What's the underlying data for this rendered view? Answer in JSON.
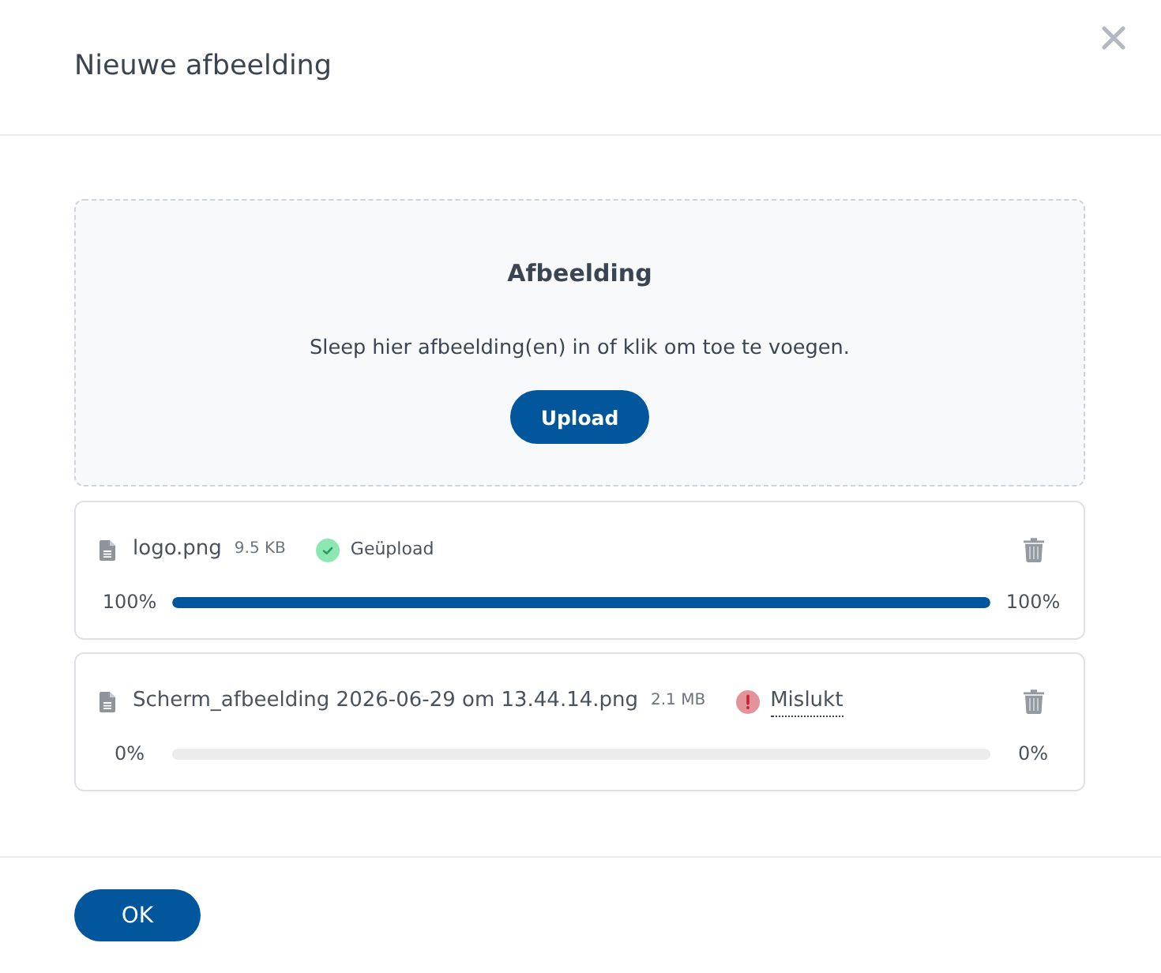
{
  "dialog": {
    "title": "Nieuwe afbeelding"
  },
  "dropzone": {
    "title": "Afbeelding",
    "instruction": "Sleep hier afbeelding(en) in of klik om toe te voegen.",
    "button": "Upload"
  },
  "files": [
    {
      "kind": "success",
      "name": "logo.png",
      "size": "9.5 KB",
      "status": "Geüpload",
      "progress_start": "100%",
      "level": 1,
      "progress_end": "100%"
    },
    {
      "kind": "error",
      "name": "Scherm_afbeelding 2026-06-29 om 13.44.14.png",
      "size": "2.1 MB",
      "status": "Mislukt",
      "progress_start": "0%",
      "level": 0,
      "progress_end": "0%"
    }
  ],
  "footer": {
    "button": "OK"
  }
}
